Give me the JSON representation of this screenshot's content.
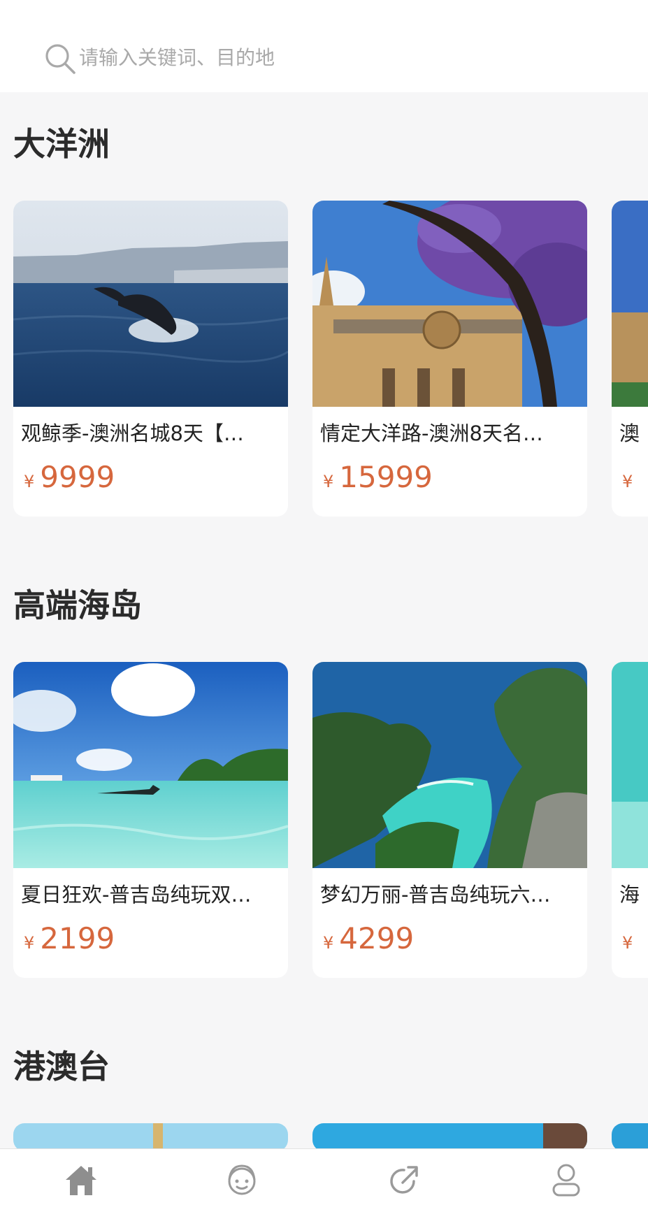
{
  "search": {
    "placeholder": "请输入关键词、目的地",
    "icon": "search-icon"
  },
  "sections": [
    {
      "title": "大洋洲",
      "cards": [
        {
          "title": "观鲸季-澳洲名城8天【…",
          "currency": "¥",
          "price": "9999",
          "image": "whale-breaching-ocean"
        },
        {
          "title": "情定大洋路-澳洲8天名…",
          "currency": "¥",
          "price": "15999",
          "image": "cathedral-jacaranda"
        },
        {
          "title": "澳",
          "currency": "¥",
          "price": "",
          "image": "partial"
        }
      ]
    },
    {
      "title": "高端海岛",
      "cards": [
        {
          "title": "夏日狂欢-普吉岛纯玩双…",
          "currency": "¥",
          "price": "2199",
          "image": "tropical-beach-snorkel"
        },
        {
          "title": "梦幻万丽-普吉岛纯玩六…",
          "currency": "¥",
          "price": "4299",
          "image": "lagoon-cliffs"
        },
        {
          "title": "海",
          "currency": "¥",
          "price": "",
          "image": "partial"
        }
      ]
    },
    {
      "title": "港澳台",
      "cards": []
    }
  ],
  "tabbar": {
    "items": [
      {
        "icon": "home-icon",
        "active": true
      },
      {
        "icon": "customer-service-icon",
        "active": false
      },
      {
        "icon": "share-icon",
        "active": false
      },
      {
        "icon": "user-icon",
        "active": false
      }
    ]
  },
  "colors": {
    "accent": "#d6673d",
    "background": "#f6f6f7",
    "card": "#ffffff",
    "title": "#2b2b2b",
    "icon": "#9a9a9a"
  }
}
